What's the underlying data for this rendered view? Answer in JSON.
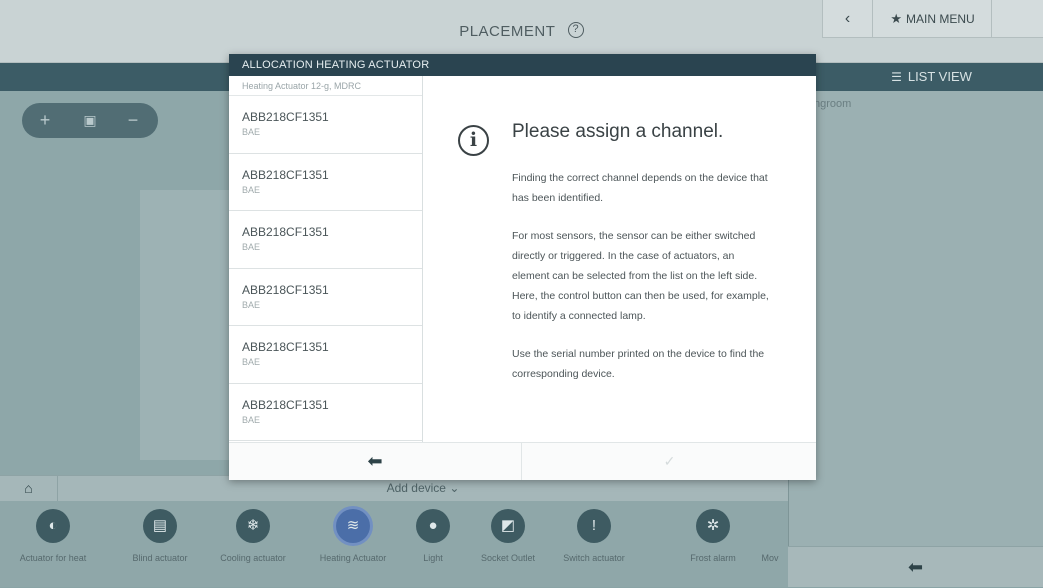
{
  "header": {
    "title": "PLACEMENT",
    "help_icon": "?",
    "back_icon": "‹",
    "main_menu_label": "MAIN MENU",
    "main_menu_icon": "★"
  },
  "toolbar": {
    "list_view_label": "LIST VIEW",
    "zoom_in": "+",
    "zoom_fit": "▣",
    "zoom_out": "−",
    "room_label": "ngroom"
  },
  "modal": {
    "title": "ALLOCATION HEATING ACTUATOR",
    "list_header": "Heating Actuator 12-g, MDRC",
    "channels": [
      {
        "name": "ABB218CF1351",
        "sub": "BAE"
      },
      {
        "name": "ABB218CF1351",
        "sub": "BAE"
      },
      {
        "name": "ABB218CF1351",
        "sub": "BAE"
      },
      {
        "name": "ABB218CF1351",
        "sub": "BAE"
      },
      {
        "name": "ABB218CF1351",
        "sub": "BAE"
      },
      {
        "name": "ABB218CF1351",
        "sub": "BAE"
      }
    ],
    "info_icon": "i",
    "assign_title": "Please assign a channel.",
    "assign_paragraphs": [
      "Finding the correct channel depends on the device that has been identified.",
      "For most sensors, the sensor can be either switched directly or triggered. In the case of actuators, an element can be selected from the list on the left side. Here, the control button can then be used, for example, to identify a connected lamp.",
      "Use the serial number printed on the device to find the corresponding device."
    ],
    "footer_back_icon": "⬅",
    "footer_confirm_icon": "✓"
  },
  "bottom": {
    "add_device_label": "Add device ⌄",
    "home_icon": "⌂",
    "devices": [
      {
        "label": "Actuator for heat",
        "icon": "◐"
      },
      {
        "label": "Blind actuator",
        "icon": "▤"
      },
      {
        "label": "Cooling actuator",
        "icon": "❄"
      },
      {
        "label": "Heating Actuator",
        "icon": "≋"
      },
      {
        "label": "Light",
        "icon": "●"
      },
      {
        "label": "Socket Outlet",
        "icon": "◩"
      },
      {
        "label": "Switch actuator",
        "icon": "!"
      },
      {
        "label": "Frost alarm",
        "icon": "✲"
      },
      {
        "label": "Mov",
        "icon": ""
      }
    ],
    "right_back_icon": "⬅"
  },
  "colors": {
    "accent_dark": "#2a4450",
    "band": "#3c5c66",
    "active_device": "#4b6ea8"
  }
}
